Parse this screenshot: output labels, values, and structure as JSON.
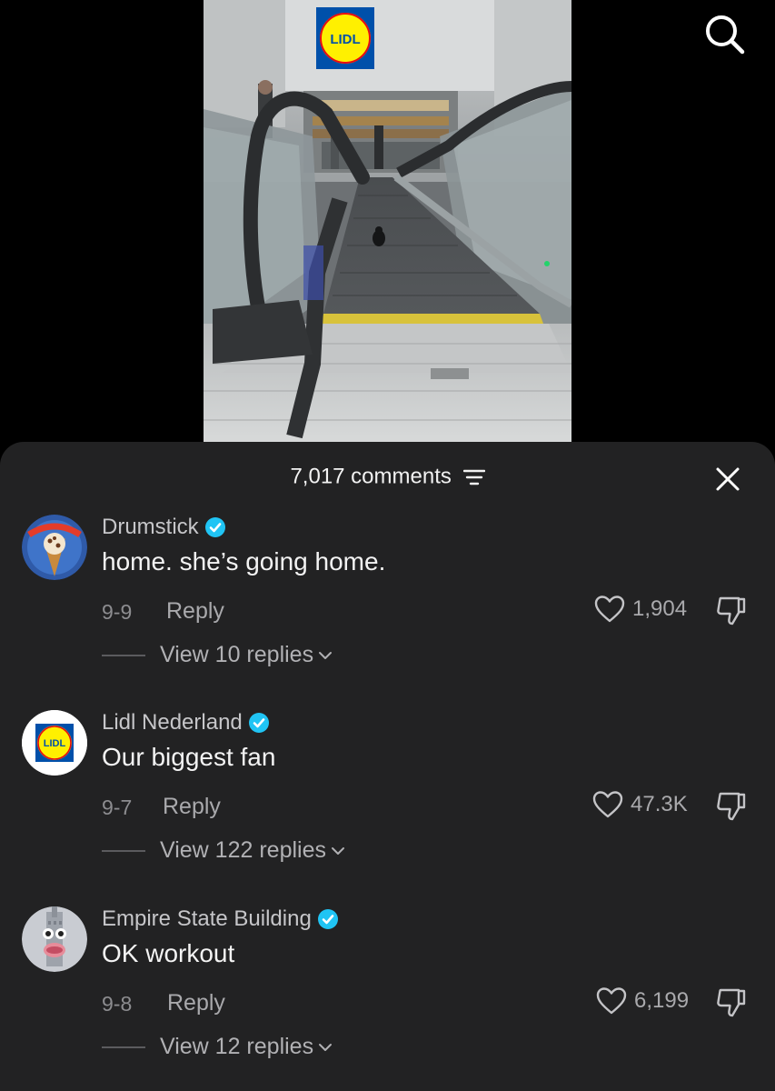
{
  "video": {
    "store_sign": "LIDL",
    "search_icon": "search-icon"
  },
  "comments_header": {
    "count_label": "7,017 comments",
    "filter_icon": "filter-icon",
    "close_icon": "close-icon"
  },
  "colors": {
    "verified": "#20c4f4",
    "sheet_background": "#222223",
    "secondary_text": "#a9a9ac",
    "lidl_yellow": "#fff000",
    "lidl_blue": "#0050aa",
    "lidl_red": "#e60a14"
  },
  "comments": [
    {
      "username": "Drumstick",
      "verified": true,
      "text": "home. she’s going home.",
      "date": "9-9",
      "reply_label": "Reply",
      "likes": "1,904",
      "view_replies": "View 10 replies",
      "avatar_label": "DRUMSTICK"
    },
    {
      "username": "Lidl Nederland",
      "verified": true,
      "text": "Our biggest fan",
      "date": "9-7",
      "reply_label": "Reply",
      "likes": "47.3K",
      "view_replies": "View 122 replies",
      "avatar_label": "LIDL"
    },
    {
      "username": "Empire State Building",
      "verified": true,
      "text": "OK workout",
      "date": "9-8",
      "reply_label": "Reply",
      "likes": "6,199",
      "view_replies": "View 12 replies"
    }
  ]
}
